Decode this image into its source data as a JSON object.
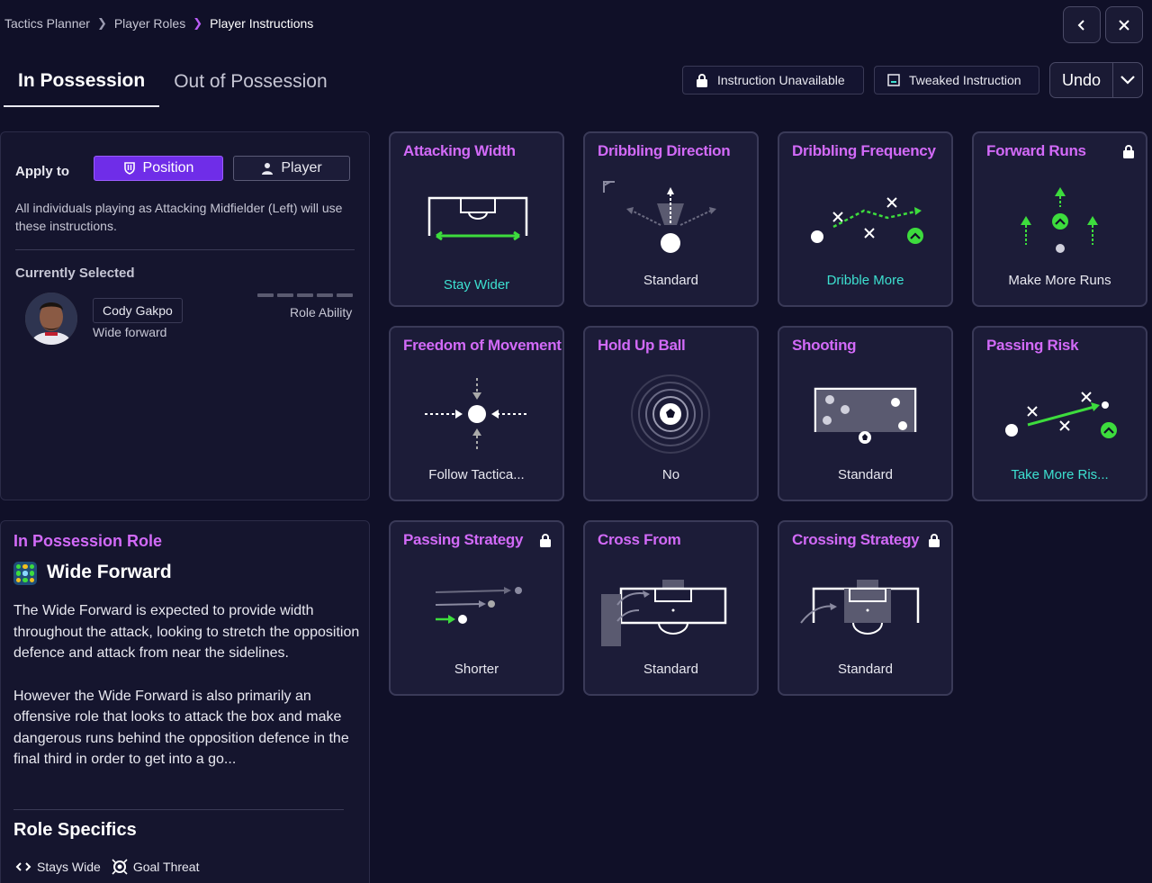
{
  "breadcrumb": {
    "items": [
      "Tactics Planner",
      "Player Roles",
      "Player Instructions"
    ]
  },
  "tabs": [
    {
      "label": "In Possession",
      "active": true
    },
    {
      "label": "Out of Possession",
      "active": false
    }
  ],
  "legend": {
    "unavailable": "Instruction Unavailable",
    "tweaked": "Tweaked Instruction"
  },
  "undo": {
    "label": "Undo"
  },
  "apply": {
    "label": "Apply to",
    "position_label": "Position",
    "player_label": "Player",
    "description": "All individuals playing as Attacking Midfielder (Left) will use these instructions.",
    "currently_selected": "Currently Selected",
    "player_name": "Cody Gakpo",
    "player_role": "Wide forward",
    "role_ability_label": "Role Ability"
  },
  "role": {
    "section_title": "In Possession Role",
    "name": "Wide Forward",
    "desc1": "The Wide Forward is expected to provide width throughout the attack, looking to stretch the opposition defence and attack from near the sidelines.",
    "desc2": "However the Wide Forward is also primarily an offensive role that looks to attack the box and make dangerous runs behind the opposition defence in the final third in order to get into a go...",
    "specifics_title": "Role Specifics",
    "specifics": [
      "Stays Wide",
      "Goal Threat"
    ]
  },
  "instructions": [
    {
      "title": "Attacking Width",
      "value": "Stay Wider",
      "changed": true,
      "locked": false
    },
    {
      "title": "Dribbling Direction",
      "value": "Standard",
      "changed": false,
      "locked": false
    },
    {
      "title": "Dribbling Frequency",
      "value": "Dribble More",
      "changed": true,
      "locked": false
    },
    {
      "title": "Forward Runs",
      "value": "Make More Runs",
      "changed": false,
      "locked": true
    },
    {
      "title": "Freedom of Movement",
      "value": "Follow Tactica...",
      "changed": false,
      "locked": false
    },
    {
      "title": "Hold Up Ball",
      "value": "No",
      "changed": false,
      "locked": false
    },
    {
      "title": "Shooting",
      "value": "Standard",
      "changed": false,
      "locked": false
    },
    {
      "title": "Passing Risk",
      "value": "Take More Ris...",
      "changed": true,
      "locked": false
    },
    {
      "title": "Passing Strategy",
      "value": "Shorter",
      "changed": false,
      "locked": true
    },
    {
      "title": "Cross From",
      "value": "Standard",
      "changed": false,
      "locked": false
    },
    {
      "title": "Crossing Strategy",
      "value": "Standard",
      "changed": false,
      "locked": true
    }
  ],
  "colors": {
    "accent_purple": "#d26af8",
    "changed_teal": "#3de0d0",
    "arrow_green": "#3ddc3d",
    "position_btn": "#6f2de8"
  }
}
